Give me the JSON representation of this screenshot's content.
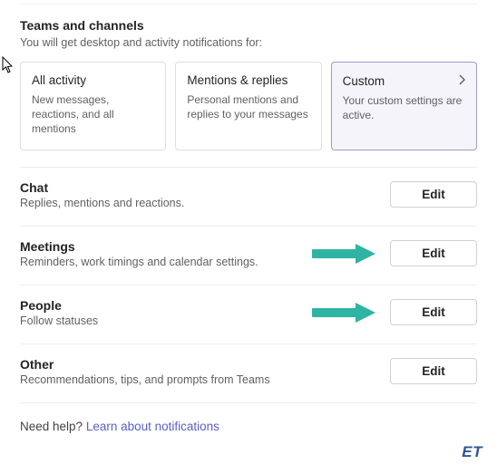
{
  "cursor_present": true,
  "teams_channels": {
    "title": "Teams and channels",
    "subtitle": "You will get desktop and activity notifications for:",
    "cards": [
      {
        "title": "All activity",
        "desc": "New messages, reactions, and all mentions",
        "selected": false
      },
      {
        "title": "Mentions & replies",
        "desc": "Personal mentions and replies to your messages",
        "selected": false
      },
      {
        "title": "Custom",
        "desc": "Your custom settings are active.",
        "selected": true
      }
    ]
  },
  "sections": [
    {
      "title": "Chat",
      "desc": "Replies, mentions and reactions.",
      "button": "Edit",
      "arrow": false
    },
    {
      "title": "Meetings",
      "desc": "Reminders, work timings and calendar settings.",
      "button": "Edit",
      "arrow": true
    },
    {
      "title": "People",
      "desc": "Follow statuses",
      "button": "Edit",
      "arrow": true
    },
    {
      "title": "Other",
      "desc": "Recommendations, tips, and prompts from Teams",
      "button": "Edit",
      "arrow": false
    }
  ],
  "help": {
    "prefix": "Need help? ",
    "link": "Learn about notifications"
  },
  "watermark": "ET"
}
